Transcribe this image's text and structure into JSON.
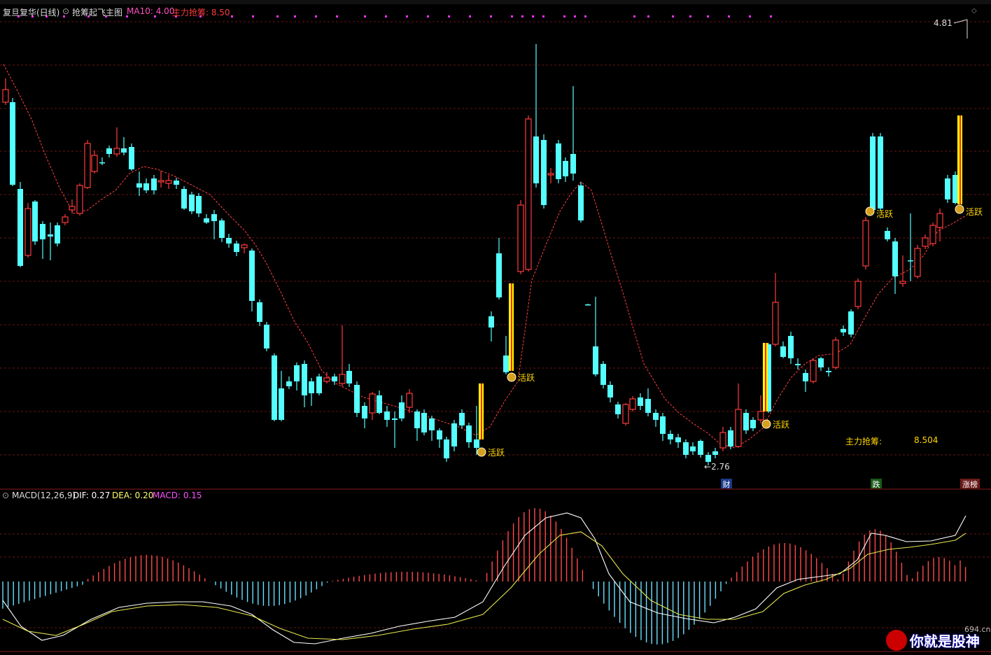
{
  "header": {
    "stock_title": "复旦复华(日线)",
    "indicator_name": "抢筹起飞主图",
    "ma10_label": "MA10: 4.00",
    "main_label": "主力抢筹: 8.50"
  },
  "price_chart": {
    "high_marker": "4.81",
    "low_marker": "2.76",
    "info_label": "主力抢筹:",
    "info_value": "8.504",
    "active_tag": "活跃",
    "badges": [
      "财",
      "跌",
      "涨榜"
    ],
    "colors": {
      "up": "#ff3b3b",
      "down": "#54ffff",
      "ma": "#ff4040",
      "signal_yellow": "#ffff00",
      "signal_red": "#ff2a00"
    }
  },
  "macd_panel": {
    "title": "MACD(12,26,9)",
    "dif": "DIF: 0.27",
    "dea": "DEA: 0.20",
    "macd": "MACD: 0.15"
  },
  "watermark": {
    "site": "694.cn",
    "slogan": "你就是股神"
  }
}
